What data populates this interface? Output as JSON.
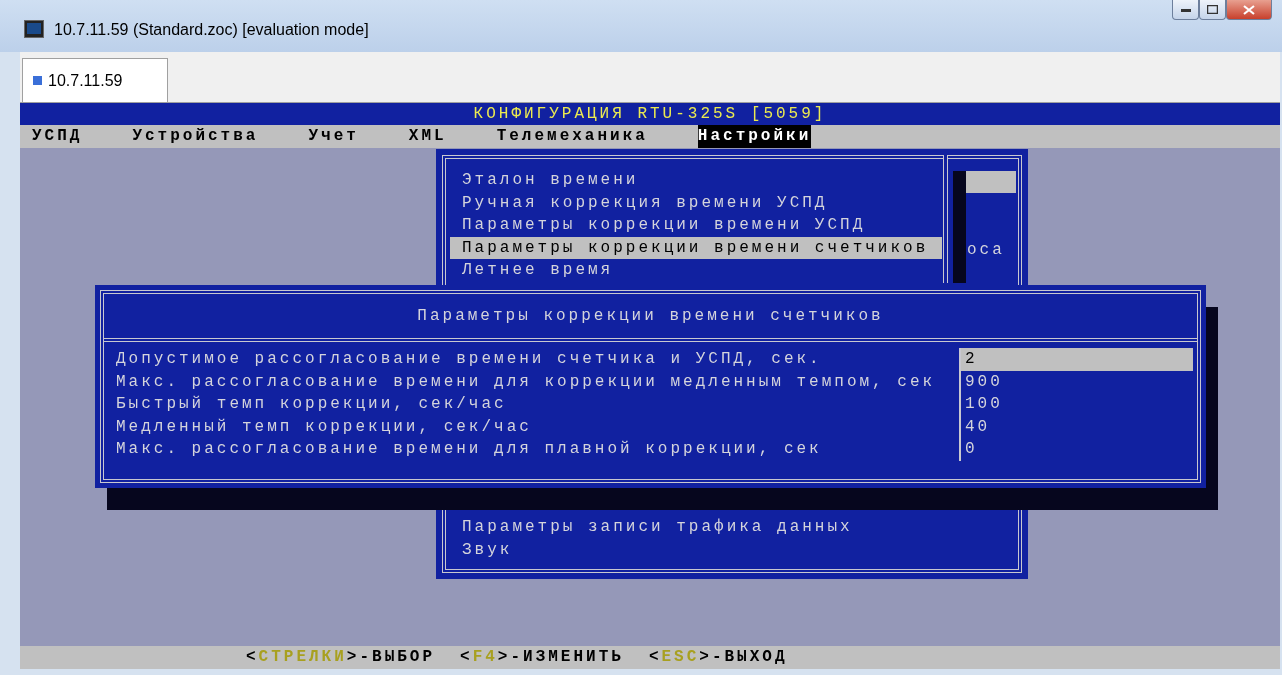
{
  "window": {
    "title": "10.7.11.59 (Standard.zoc) [evaluation mode]"
  },
  "tabs": [
    {
      "label": "10.7.11.59",
      "selected": true
    }
  ],
  "terminal": {
    "title": "КОНФИГУРАЦИЯ RTU-325S [5059]",
    "menu": [
      {
        "label": "УСПД",
        "selected": false
      },
      {
        "label": "Устройства",
        "selected": false
      },
      {
        "label": "Учет",
        "selected": false
      },
      {
        "label": "XML",
        "selected": false
      },
      {
        "label": "Телемеханика",
        "selected": false
      },
      {
        "label": "Настройки",
        "selected": true
      }
    ],
    "dropdown": {
      "items": [
        {
          "label": "Эталон времени",
          "selected": false
        },
        {
          "label": "Ручная коррекция времени УСПД",
          "selected": false
        },
        {
          "label": "Параметры коррекции времени УСПД",
          "selected": false
        },
        {
          "label": "Параметры коррекции времени счетчиков",
          "selected": true
        },
        {
          "label": "Летнее время",
          "selected": false
        }
      ],
      "items_lower": [
        {
          "label": "Параметры записи трафика данных",
          "selected": false
        },
        {
          "label": "Звук",
          "selected": false
        }
      ],
      "background_fragment": "оса"
    },
    "dialog": {
      "title": "Параметры коррекции времени счетчиков",
      "rows": [
        {
          "label": "Допустимое рассогласование времени счетчика и УСПД, сек.",
          "value": "2",
          "selected": true
        },
        {
          "label": "Макс. рассогласование времени для коррекции медленным темпом, сек",
          "value": "900",
          "selected": false
        },
        {
          "label": "Быстрый темп коррекции, сек/час",
          "value": "100",
          "selected": false
        },
        {
          "label": "Медленный темп коррекции, сек/час",
          "value": "40",
          "selected": false
        },
        {
          "label": "Макс. рассогласование времени для плавной коррекции, сек",
          "value": "0",
          "selected": false
        }
      ]
    },
    "status_bar": [
      {
        "open": "<",
        "key": "СТРЕЛКИ",
        "rest": ">-ВЫБОР"
      },
      {
        "open": "<",
        "key": "F4",
        "rest": ">-ИЗМЕНИТЬ"
      },
      {
        "open": "<",
        "key": "ESC",
        "rest": ">-ВЫХОД"
      }
    ]
  }
}
